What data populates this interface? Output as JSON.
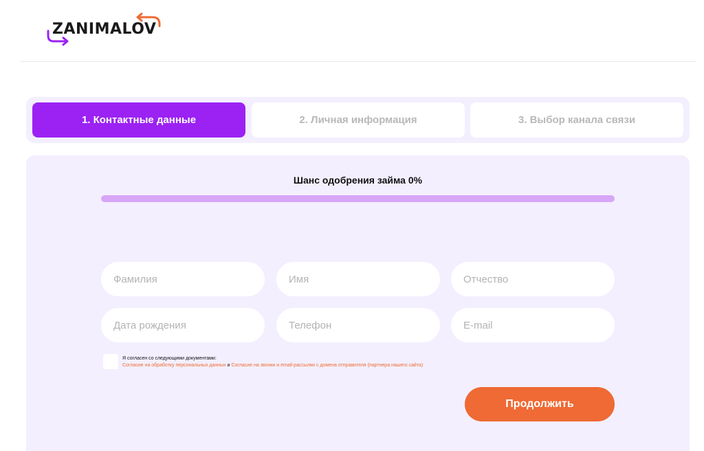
{
  "brand": {
    "name": "ZANIMALOV",
    "colors": {
      "purple": "#9b22f2",
      "orange": "#ef6a34",
      "background": "#f3efff",
      "progress_track": "#d8a6f7"
    }
  },
  "steps": [
    {
      "label": "1. Контактные данные",
      "active": true
    },
    {
      "label": "2. Личная информация",
      "active": false
    },
    {
      "label": "3. Выбор канала связи",
      "active": false
    }
  ],
  "approval": {
    "label": "Шанс одобрения займа 0%",
    "progress_percent": 0
  },
  "form": {
    "fields": [
      {
        "placeholder": "Фамилия",
        "value": ""
      },
      {
        "placeholder": "Имя",
        "value": ""
      },
      {
        "placeholder": "Отчество",
        "value": ""
      },
      {
        "placeholder": "Дата рождения",
        "value": ""
      },
      {
        "placeholder": "Телефон",
        "value": ""
      },
      {
        "placeholder": "E-mail",
        "value": ""
      }
    ],
    "consent": {
      "checked": false,
      "title": "Я согласен со следующими документами:",
      "link1": "Согласие на обработку персональных данных",
      "conjunction": " и ",
      "link2": "Согласие на звонки и email-рассылки с домена отправителя (партнера нашего сайта)"
    },
    "submit_label": "Продолжить"
  }
}
